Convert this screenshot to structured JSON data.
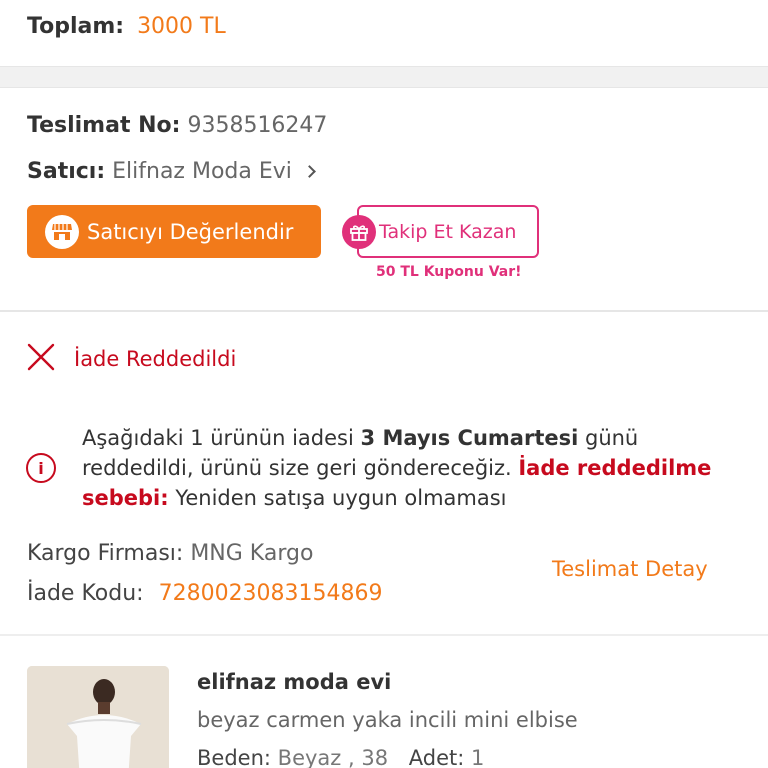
{
  "total": {
    "label": "Toplam:",
    "value": "3000 TL"
  },
  "delivery": {
    "number_label": "Teslimat No:",
    "number_value": "9358516247",
    "seller_label": "Satıcı:",
    "seller_value": "Elifnaz Moda Evi",
    "rate_button": "Satıcıyı Değerlendir",
    "follow_button": "Takip Et Kazan",
    "coupon_text": "50 TL Kuponu Var!"
  },
  "return_info": {
    "status": "İade Reddedildi",
    "msg_part1": "Aşağıdaki 1 ürünün iadesi ",
    "msg_date": "3 Mayıs Cumartesi",
    "msg_part2": " günü reddedildi, ürünü size geri göndereceğiz. ",
    "msg_reason_label": "İade reddedilme sebebi:",
    "msg_reason": " Yeniden satışa uygun olmaması",
    "cargo_label": "Kargo Firması:",
    "cargo_value": "MNG Kargo",
    "code_label": "İade Kodu:",
    "code_value": "7280023083154869",
    "detail_link": "Teslimat Detay"
  },
  "product": {
    "seller": "elifnaz moda evi",
    "name": "beyaz carmen yaka incili mini elbise",
    "size_label": "Beden:",
    "size_value": "Beyaz , 38",
    "qty_label": "Adet:",
    "qty_value": "1"
  },
  "colors": {
    "accent": "#f27a1a",
    "error": "#c70a1e",
    "promo": "#e0307a"
  },
  "icons": {
    "store": "store-icon",
    "gift": "gift-icon",
    "close": "close-x-icon",
    "info": "info-icon",
    "chevron": "chevron-right-icon"
  }
}
